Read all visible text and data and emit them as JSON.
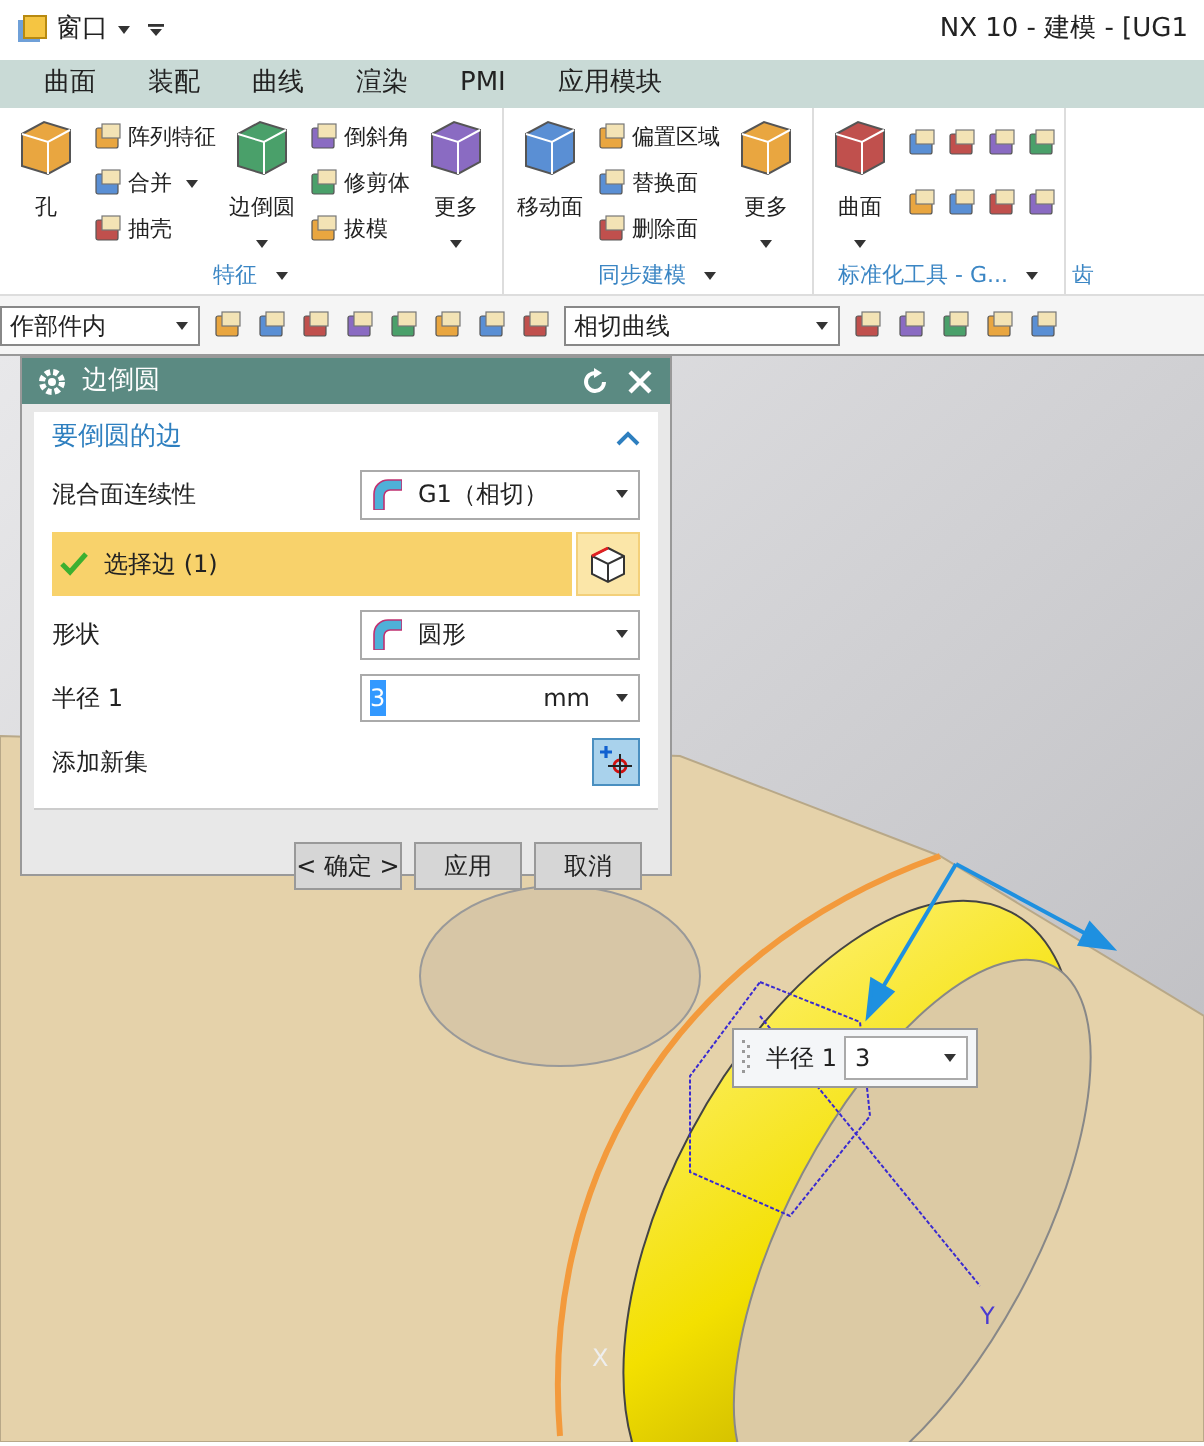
{
  "title_bar": {
    "menu": "窗口",
    "title": "NX 10 - 建模 - [UG1"
  },
  "ribbon_tabs": [
    "曲面",
    "装配",
    "曲线",
    "渲染",
    "PMI",
    "应用模块"
  ],
  "ribbon_groups": [
    {
      "label": "特征",
      "has_menu": true,
      "items": [
        {
          "kind": "large",
          "label": "孔",
          "has_menu": false
        },
        {
          "kind": "small",
          "label": "阵列特征",
          "has_menu": false
        },
        {
          "kind": "small",
          "label": "合并",
          "has_menu": true
        },
        {
          "kind": "small",
          "label": "抽壳",
          "has_menu": false
        },
        {
          "kind": "large",
          "label": "边倒圆",
          "has_menu": true
        },
        {
          "kind": "small",
          "label": "倒斜角",
          "has_menu": false
        },
        {
          "kind": "small",
          "label": "修剪体",
          "has_menu": false
        },
        {
          "kind": "small",
          "label": "拔模",
          "has_menu": false
        },
        {
          "kind": "large",
          "label": "更多",
          "has_menu": true
        }
      ]
    },
    {
      "label": "同步建模",
      "has_menu": true,
      "items": [
        {
          "kind": "large",
          "label": "移动面",
          "has_menu": false
        },
        {
          "kind": "small",
          "label": "偏置区域",
          "has_menu": false
        },
        {
          "kind": "small",
          "label": "替换面",
          "has_menu": false
        },
        {
          "kind": "small",
          "label": "删除面",
          "has_menu": false
        },
        {
          "kind": "large",
          "label": "更多",
          "has_menu": true
        }
      ]
    },
    {
      "label": "标准化工具 - G...",
      "has_menu": true,
      "items": [
        {
          "kind": "large",
          "label": "曲面",
          "has_menu": true
        },
        {
          "kind": "icon_grid"
        }
      ]
    },
    {
      "label": "齿",
      "has_menu": false
    }
  ],
  "toolbar": {
    "filter": "作部件内",
    "curve_rule": "相切曲线"
  },
  "dialog": {
    "title": "边倒圆",
    "section": {
      "title": "要倒圆的边",
      "expanded": true
    },
    "rows": [
      {
        "kind": "dropdown",
        "label": "混合面连续性",
        "value": "G1（相切）"
      },
      {
        "kind": "select",
        "label": "选择边 (1)",
        "done": true
      },
      {
        "kind": "dropdown",
        "label": "形状",
        "value": "圆形"
      },
      {
        "kind": "number",
        "label": "半径 1",
        "value": "3",
        "unit": "mm"
      },
      {
        "kind": "add",
        "label": "添加新集"
      }
    ],
    "buttons": [
      "< 确定 >",
      "应用",
      "取消"
    ]
  },
  "floating_input": {
    "label": "半径 1",
    "value": "3"
  },
  "axes": [
    "X",
    "Y"
  ]
}
